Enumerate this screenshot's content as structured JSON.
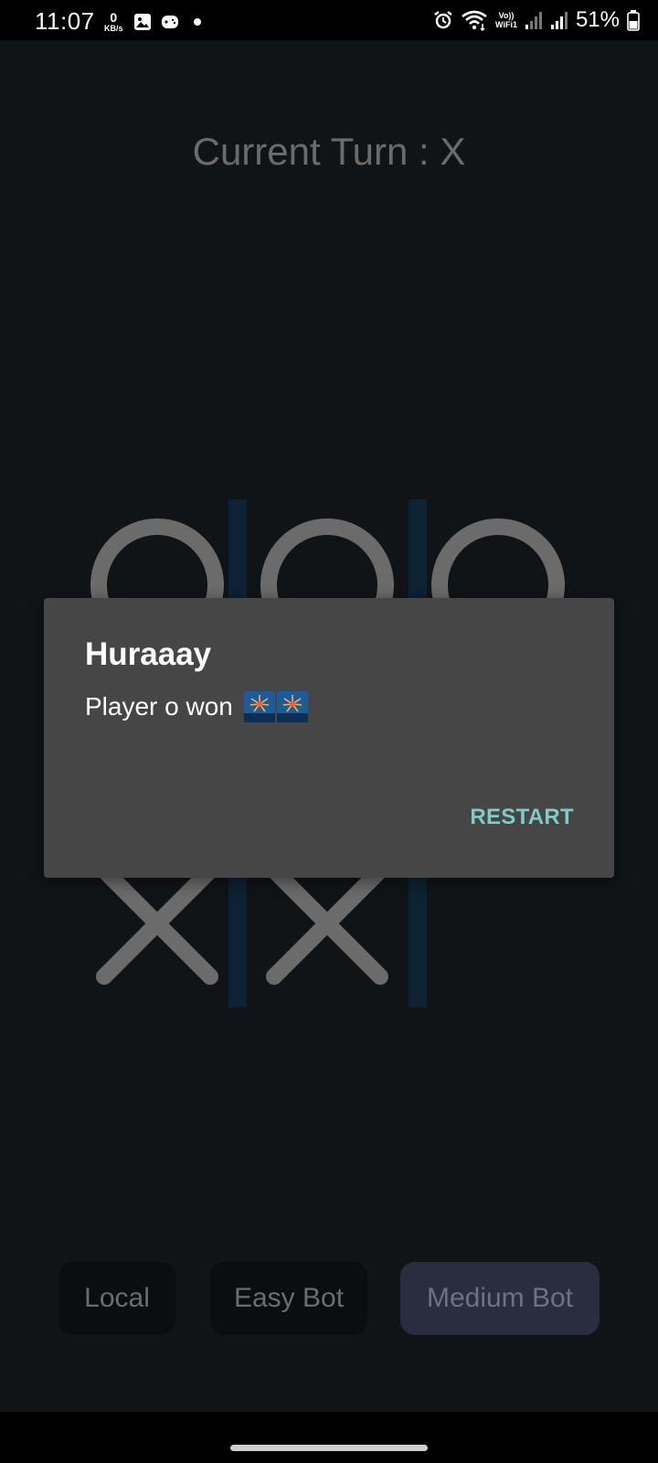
{
  "status_bar": {
    "time": "11:07",
    "net_speed_value": "0",
    "net_speed_unit": "KB/s",
    "battery": "51%",
    "icons": [
      "gallery-icon",
      "game-icon",
      "dot-icon",
      "alarm-icon",
      "wifi-icon",
      "vowifi-icon",
      "signal-icon",
      "signal-icon-2",
      "battery-icon"
    ],
    "vowifi_top": "Vo))",
    "vowifi_bottom": "WiFi1"
  },
  "game": {
    "turn_label": "Current Turn : X",
    "board": [
      [
        "O",
        "O",
        "O"
      ],
      [
        "",
        "",
        ""
      ],
      [
        "X",
        "X",
        ""
      ]
    ],
    "grid_color": "#0d2233",
    "mark_color": "#6b6b6b"
  },
  "modes": {
    "local": "Local",
    "easy": "Easy Bot",
    "medium": "Medium Bot",
    "selected": "Medium Bot"
  },
  "dialog": {
    "title": "Huraaay",
    "message": "Player o won",
    "emoji": [
      "fireworks-icon",
      "fireworks-icon"
    ],
    "button": "RESTART",
    "accent": "#80cbc4"
  }
}
